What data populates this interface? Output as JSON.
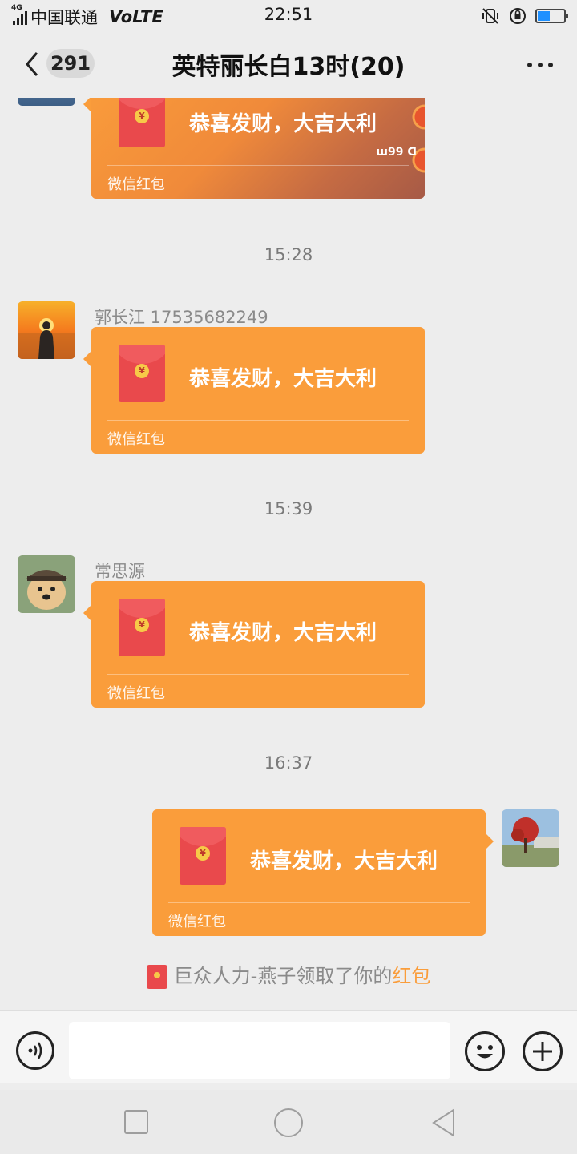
{
  "status_bar": {
    "network": "4G",
    "carrier": "中国联通",
    "volte": "VoLTE",
    "time": "22:51",
    "battery_level": 0.45
  },
  "header": {
    "unread_count": "291",
    "title": "英特丽长白13时(20)"
  },
  "messages": [
    {
      "type": "red_packet",
      "side": "left",
      "sender": "",
      "wish": "恭喜发财，大吉大利",
      "label": "微信红包",
      "cover_mark": "ɯ99 ᗡ"
    },
    {
      "type": "time",
      "text": "15:28"
    },
    {
      "type": "red_packet",
      "side": "left",
      "sender": "郭长江 17535682249",
      "wish": "恭喜发财，大吉大利",
      "label": "微信红包"
    },
    {
      "type": "time",
      "text": "15:39"
    },
    {
      "type": "red_packet",
      "side": "left",
      "sender": "常思源",
      "wish": "恭喜发财，大吉大利",
      "label": "微信红包"
    },
    {
      "type": "time",
      "text": "16:37"
    },
    {
      "type": "red_packet",
      "side": "right",
      "wish": "恭喜发财，大吉大利",
      "label": "微信红包"
    },
    {
      "type": "system",
      "text_prefix": "巨众人力-燕子领取了你的",
      "highlight": "红包"
    }
  ],
  "input_bar": {
    "voice_icon": "voice-icon",
    "emoji_icon": "emoji-icon",
    "plus_icon": "plus-icon",
    "text_value": ""
  },
  "colors": {
    "packet_orange": "#fa9d3b",
    "envelope_red": "#e9494c",
    "highlight": "#fa9d3b"
  }
}
